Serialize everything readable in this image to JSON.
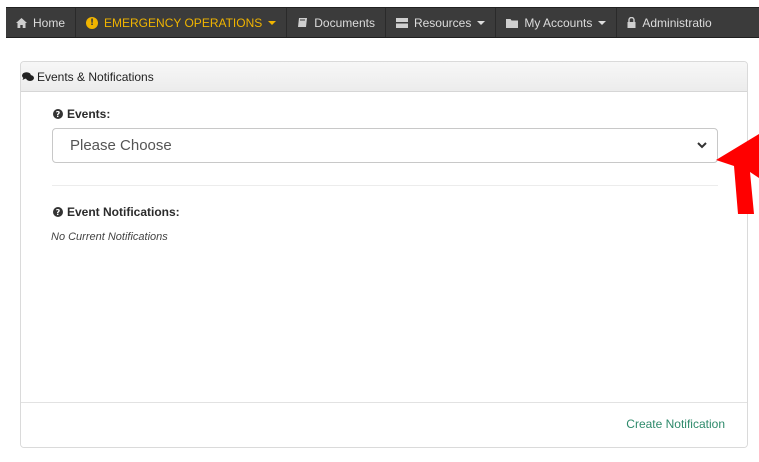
{
  "nav": {
    "items": [
      {
        "label": "Home",
        "icon": "home-icon"
      },
      {
        "label": "EMERGENCY OPERATIONS",
        "icon": "exclamation-circle-icon",
        "active": true,
        "dropdown": true
      },
      {
        "label": "Documents",
        "icon": "book-icon"
      },
      {
        "label": "Resources",
        "icon": "server-icon",
        "dropdown": true
      },
      {
        "label": "My Accounts",
        "icon": "folder-icon",
        "dropdown": true
      },
      {
        "label": "Administratio",
        "icon": "lock-icon"
      }
    ],
    "active_color": "#f0b400"
  },
  "panel": {
    "title": "Events & Notifications",
    "events_label": "Events:",
    "events_select_value": "Please Choose",
    "notifications_label": "Event Notifications:",
    "notifications_empty": "No Current Notifications",
    "footer_link": "Create Notification"
  },
  "colors": {
    "nav_bg": "#3b3b3b",
    "link": "#2e8a6b",
    "annotation_arrow": "#ff0000"
  }
}
